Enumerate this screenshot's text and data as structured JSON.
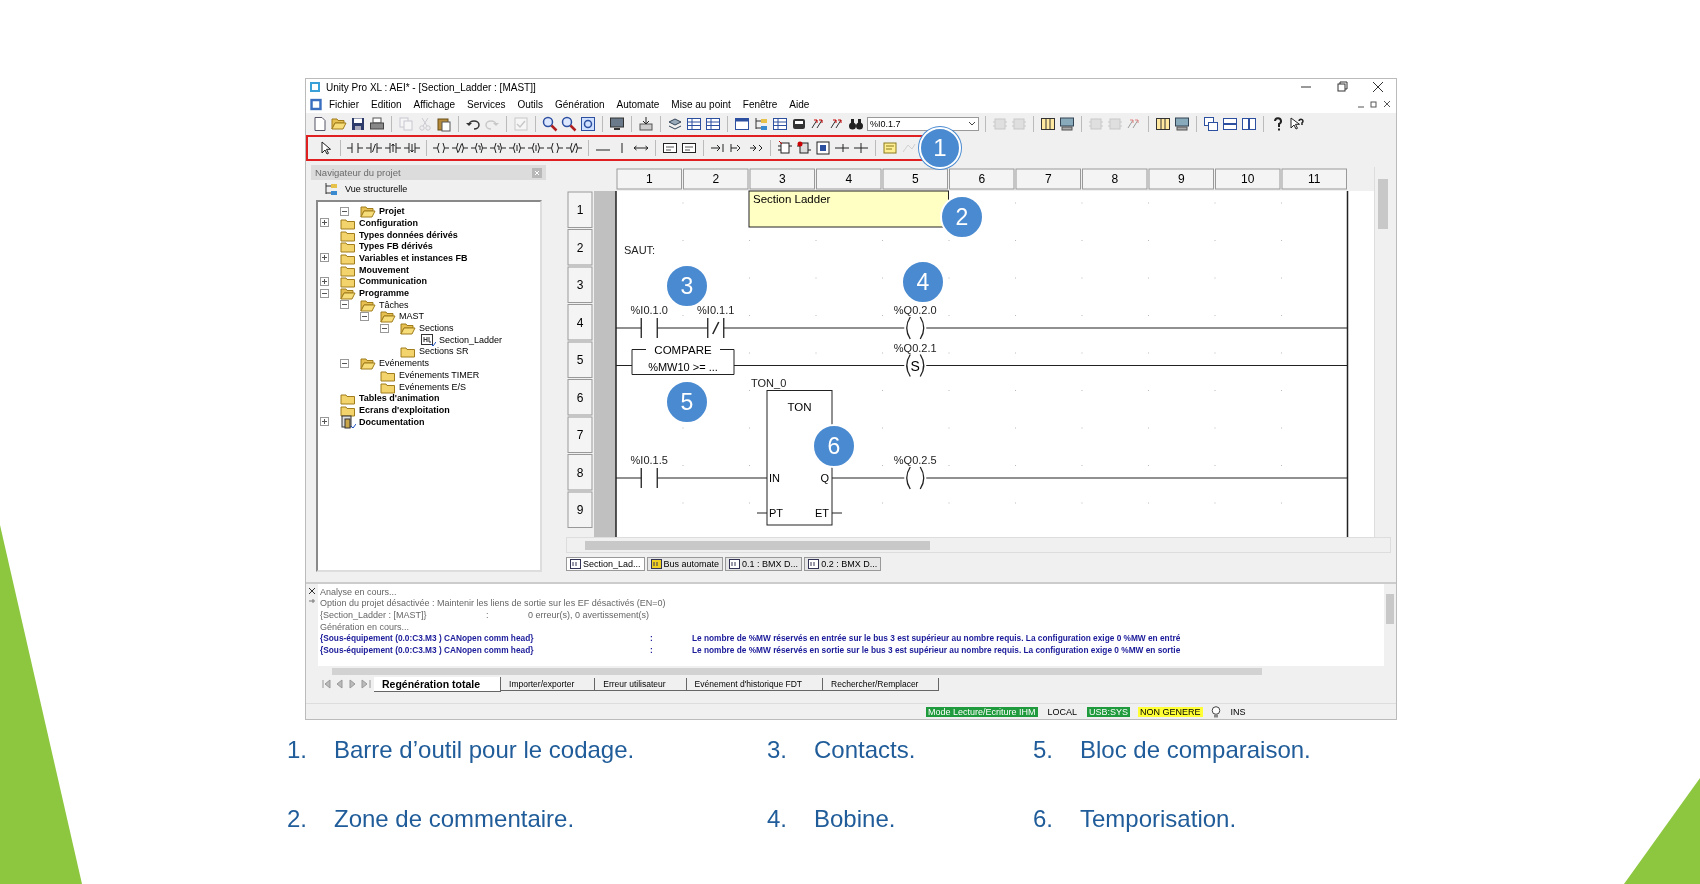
{
  "window": {
    "title": "Unity Pro XL : AEI* - [Section_Ladder : [MAST]]"
  },
  "menu": [
    "Fichier",
    "Edition",
    "Affichage",
    "Services",
    "Outils",
    "Génération",
    "Automate",
    "Mise au point",
    "Fenêtre",
    "Aide"
  ],
  "toolbar": {
    "address_field": {
      "value": "%I0.1.7"
    }
  },
  "coding_toolbar": {
    "callout": "1"
  },
  "navigator": {
    "title": "Navigateur du projet",
    "view": "Vue structurelle",
    "tree": [
      {
        "label": "Projet",
        "expanded": true,
        "children": [
          {
            "label": "Configuration",
            "expanded": false
          },
          {
            "label": "Types données dérivés"
          },
          {
            "label": "Types FB dérivés"
          },
          {
            "label": "Variables et instances FB",
            "expanded": false
          },
          {
            "label": "Mouvement"
          },
          {
            "label": "Communication",
            "expanded": false
          },
          {
            "label": "Programme",
            "expanded": true,
            "children": [
              {
                "label": "Tâches",
                "expanded": true,
                "children": [
                  {
                    "label": "MAST",
                    "expanded": true,
                    "children": [
                      {
                        "label": "Sections",
                        "expanded": true,
                        "children": [
                          {
                            "label": "Section_Ladder",
                            "kind": "section"
                          }
                        ]
                      },
                      {
                        "label": "Sections SR"
                      }
                    ]
                  }
                ]
              },
              {
                "label": "Evénements",
                "expanded": true,
                "children": [
                  {
                    "label": "Evénements TIMER"
                  },
                  {
                    "label": "Evénements E/S"
                  }
                ]
              }
            ]
          },
          {
            "label": "Tables d'animation"
          },
          {
            "label": "Ecrans d'exploitation"
          },
          {
            "label": "Documentation",
            "expanded": false,
            "kind": "documentation"
          }
        ]
      }
    ]
  },
  "ladder": {
    "columns": [
      "1",
      "2",
      "3",
      "4",
      "5",
      "6",
      "7",
      "8",
      "9",
      "10",
      "11"
    ],
    "rows": [
      "1",
      "2",
      "3",
      "4",
      "5",
      "6",
      "7",
      "8",
      "9"
    ],
    "comment": "Section Ladder",
    "jump_label": "SAUT:",
    "rungs": [
      {
        "contacts": [
          {
            "address": "%I0.1.0",
            "negated": false
          },
          {
            "address": "%I0.1.1",
            "negated": true
          }
        ],
        "coil": {
          "address": "%Q0.2.0"
        }
      },
      {
        "compare": {
          "title": "COMPARE",
          "expression": "%MW10 >= ..."
        },
        "coil": {
          "address": "%Q0.2.1",
          "mark": "S"
        }
      },
      {
        "contacts": [
          {
            "address": "%I0.1.5",
            "negated": false
          }
        ],
        "block": {
          "instance": "TON_0",
          "type": "TON",
          "inputs": [
            "IN",
            "PT"
          ],
          "outputs": [
            "Q",
            "ET"
          ]
        },
        "coil": {
          "address": "%Q0.2.5"
        }
      }
    ],
    "callouts": [
      "2",
      "3",
      "4",
      "5",
      "6"
    ]
  },
  "editor_tabs": [
    {
      "label": "Section_Lad...",
      "selected": true
    },
    {
      "label": "Bus automate",
      "selected": false
    },
    {
      "label": "0.1 : BMX D...",
      "selected": false
    },
    {
      "label": "0.2 : BMX D...",
      "selected": false
    }
  ],
  "output": {
    "lines": [
      {
        "kind": "info",
        "parts": [
          "Analyse en cours..."
        ]
      },
      {
        "kind": "info",
        "parts": [
          "Option du projet désactivée : Maintenir les liens de sortie sur les EF désactivés (EN=0)"
        ]
      },
      {
        "kind": "info",
        "parts": [
          "{Section_Ladder : [MAST]}",
          ":",
          "0 erreur(s), 0 avertissement(s)"
        ]
      },
      {
        "kind": "info",
        "parts": [
          "Génération en cours..."
        ]
      },
      {
        "kind": "error",
        "parts": [
          "{Sous-équipement (0.0:C3.M3 ) CANopen comm head}",
          ":",
          "Le nombre de %MW réservés en entrée sur le bus 3 est supérieur au nombre requis. La configuration exige 0 %MW en entré"
        ]
      },
      {
        "kind": "error",
        "parts": [
          "{Sous-équipement (0.0:C3.M3 ) CANopen comm head}",
          ":",
          "Le nombre de %MW réservés en sortie sur le bus 3 est supérieur au nombre requis. La configuration exige 0 %MW en sortie"
        ]
      }
    ],
    "tabs": [
      {
        "label": "Regénération totale",
        "selected": true
      },
      {
        "label": "Importer/exporter",
        "selected": false
      },
      {
        "label": "Erreur utilisateur",
        "selected": false
      },
      {
        "label": "Evénement d'historique FDT",
        "selected": false
      },
      {
        "label": "Rechercher/Remplacer",
        "selected": false
      }
    ]
  },
  "status_bar": [
    {
      "text": "Mode Lecture/Ecriture IHM",
      "color": "#1f9a3c"
    },
    {
      "text": "LOCAL"
    },
    {
      "text": "USB:SYS",
      "color": "#1f9a3c"
    },
    {
      "text": "NON GENERE",
      "color": "#ffff33"
    },
    {
      "text": "INS"
    }
  ],
  "legend": [
    {
      "number": "1.",
      "text": "Barre d’outil pour le codage."
    },
    {
      "number": "2.",
      "text": "Zone de commentaire."
    },
    {
      "number": "3.",
      "text": "Contacts."
    },
    {
      "number": "4.",
      "text": "Bobine."
    },
    {
      "number": "5.",
      "text": "Bloc de comparaison."
    },
    {
      "number": "6.",
      "text": "Temporisation."
    }
  ]
}
